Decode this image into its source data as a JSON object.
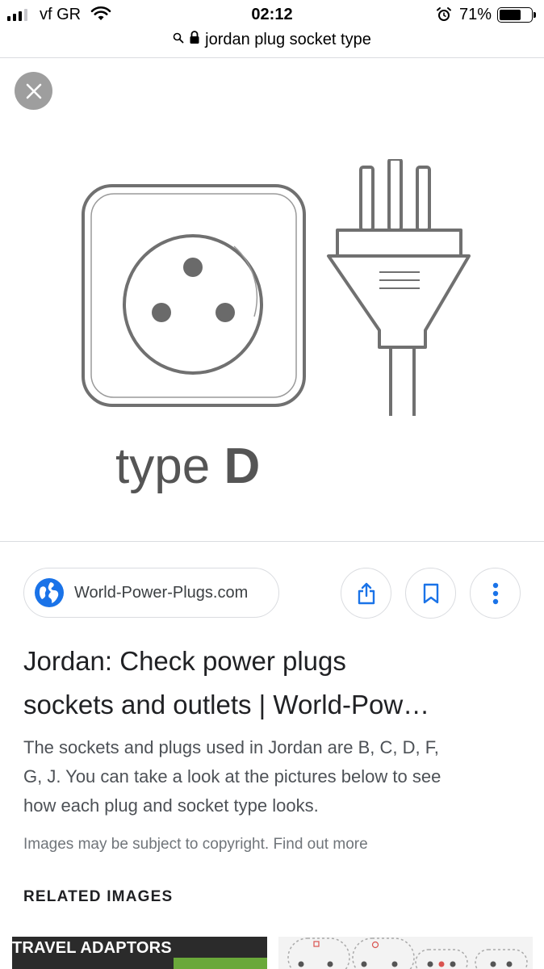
{
  "status_bar": {
    "carrier": "vf GR",
    "time": "02:12",
    "battery_percent": "71%",
    "battery_level": 0.71,
    "icons": [
      "signal-icon",
      "wifi-icon",
      "alarm-icon",
      "battery-icon"
    ]
  },
  "url_bar": {
    "query": "jordan plug socket type",
    "icons": [
      "search-icon",
      "lock-icon"
    ]
  },
  "viewer": {
    "close_icon": "close-icon",
    "image_caption_prefix": "type",
    "image_caption_letter": "D"
  },
  "source": {
    "name": "World-Power-Plugs.com",
    "icon": "globe-icon"
  },
  "actions": [
    {
      "name": "share-button",
      "icon": "share-icon"
    },
    {
      "name": "save-button",
      "icon": "bookmark-icon"
    },
    {
      "name": "more-button",
      "icon": "more-vert-icon"
    }
  ],
  "result": {
    "title_line1": "Jordan: Check power plugs",
    "title_line2": "sockets and outlets | World-Pow…",
    "snippet_line1": "The sockets and plugs used in Jordan are B, C, D, F,",
    "snippet_line2": "G, J. You can take a look at the pictures below to see",
    "snippet_line3": "how each plug and socket type looks.",
    "copyright_text": "Images may be subject to copyright.",
    "find_out_more": "Find out more"
  },
  "related": {
    "heading": "RELATED IMAGES",
    "thumbs": [
      {
        "label": "TRAVEL ADAPTORS"
      },
      {
        "label": ""
      }
    ]
  },
  "colors": {
    "accent_blue": "#1a73e8",
    "text_primary": "#202124",
    "text_secondary": "#4d5156",
    "muted": "#70757a",
    "border": "#dadce0",
    "close_button_bg": "#9e9e9e",
    "illustration_stroke": "#707070"
  }
}
